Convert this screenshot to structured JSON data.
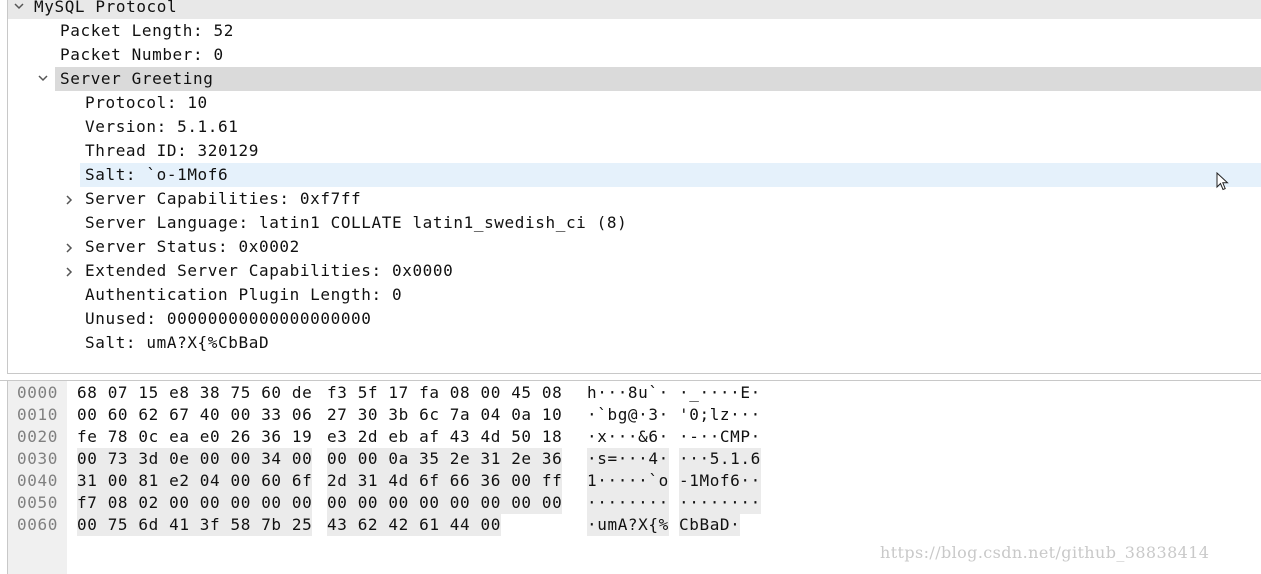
{
  "tree": {
    "root": {
      "label": "MySQL Protocol"
    },
    "packet_length": {
      "label": "Packet Length: 52"
    },
    "packet_number": {
      "label": "Packet Number: 0"
    },
    "server_greeting": {
      "label": "Server Greeting"
    },
    "protocol": {
      "label": "Protocol: 10"
    },
    "version": {
      "label": "Version: 5.1.61"
    },
    "thread_id": {
      "label": "Thread ID: 320129"
    },
    "salt1": {
      "label": "Salt: `o-1Mof6"
    },
    "server_capabilities": {
      "label": "Server Capabilities: 0xf7ff"
    },
    "server_language": {
      "label": "Server Language: latin1 COLLATE latin1_swedish_ci (8)"
    },
    "server_status": {
      "label": "Server Status: 0x0002"
    },
    "extended_capabilities": {
      "label": "Extended Server Capabilities: 0x0000"
    },
    "auth_plugin_length": {
      "label": "Authentication Plugin Length: 0"
    },
    "unused": {
      "label": "Unused: 00000000000000000000"
    },
    "salt2": {
      "label": "Salt: umA?X{%CbBaD"
    }
  },
  "hex": {
    "rows": [
      {
        "offset": "0000",
        "hex_a": "68 07 15 e8 38 75 60 de",
        "hex_b": "f3 5f 17 fa 08 00 45 08",
        "ascii_a": "h···8u`·",
        "ascii_b": "·_····E·"
      },
      {
        "offset": "0010",
        "hex_a": "00 60 62 67 40 00 33 06",
        "hex_b": "27 30 3b 6c 7a 04 0a 10",
        "ascii_a": "·`bg@·3·",
        "ascii_b": "'0;lz···"
      },
      {
        "offset": "0020",
        "hex_a": "fe 78 0c ea e0 26 36 19",
        "hex_b": "e3 2d eb af 43 4d 50 18",
        "ascii_a": "·x···&6·",
        "ascii_b": "·-··CMP·"
      },
      {
        "offset": "0030",
        "hex_a": "00 73 3d 0e 00 00 34 00",
        "hex_b": "00 00 0a 35 2e 31 2e 36",
        "ascii_a": "·s=···4·",
        "ascii_b": "···5.1.6"
      },
      {
        "offset": "0040",
        "hex_a": "31 00 81 e2 04 00 60 6f",
        "hex_b": "2d 31 4d 6f 66 36 00 ff",
        "ascii_a": "1·····`o",
        "ascii_b": "-1Mof6··"
      },
      {
        "offset": "0050",
        "hex_a": "f7 08 02 00 00 00 00 00",
        "hex_b": "00 00 00 00 00 00 00 00",
        "ascii_a": "········",
        "ascii_b": "········"
      },
      {
        "offset": "0060",
        "hex_a": "00 75 6d 41 3f 58 7b 25",
        "hex_b": "43 62 42 61 44 00",
        "ascii_a": "·umA?X{%",
        "ascii_b": "CbBaD·"
      }
    ]
  },
  "watermark": {
    "text": "https://blog.csdn.net/github_38838414"
  },
  "colors": {
    "selected_row": "#dadada",
    "hover_row": "#e5f1fb",
    "hex_highlight": "#ebebeb",
    "offset_text": "#808080"
  },
  "icons": {
    "expanded": "chevron-down-icon",
    "collapsed": "chevron-right-icon",
    "cursor": "mouse-pointer-icon"
  }
}
